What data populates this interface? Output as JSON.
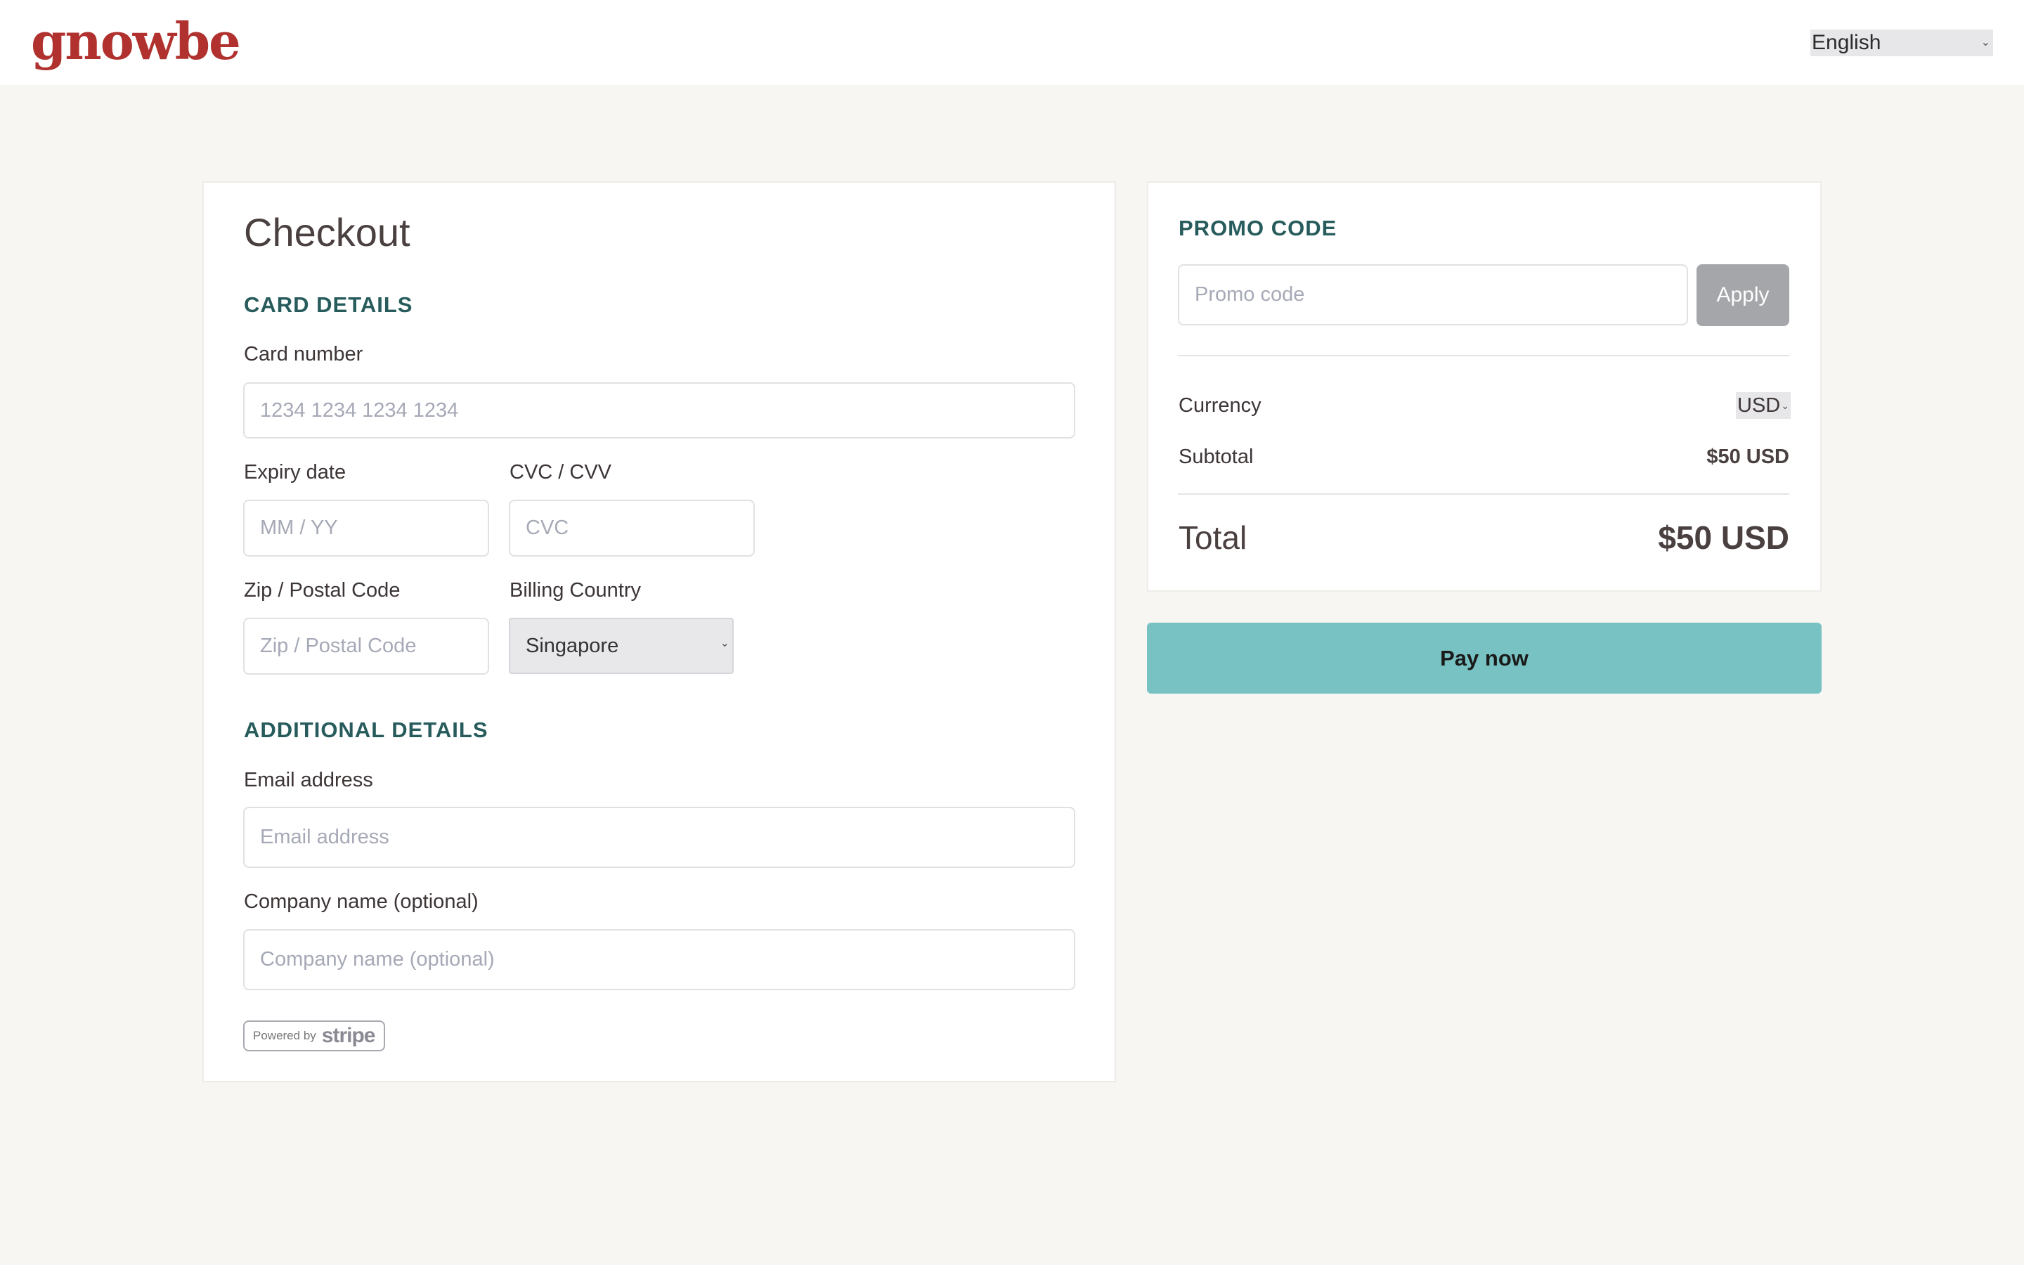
{
  "header": {
    "logo": "gnowbe",
    "language": "English"
  },
  "checkout": {
    "title": "Checkout",
    "card_section": "CARD DETAILS",
    "card_number_label": "Card number",
    "card_number_placeholder": "1234 1234 1234 1234",
    "expiry_label": "Expiry date",
    "expiry_placeholder": "MM / YY",
    "cvc_label": "CVC / CVV",
    "cvc_placeholder": "CVC",
    "zip_label": "Zip / Postal Code",
    "zip_placeholder": "Zip / Postal Code",
    "country_label": "Billing Country",
    "country_value": "Singapore",
    "additional_section": "ADDITIONAL DETAILS",
    "email_label": "Email address",
    "email_placeholder": "Email address",
    "company_label": "Company name (optional)",
    "company_placeholder": "Company name (optional)",
    "stripe_powered": "Powered by",
    "stripe_brand": "stripe"
  },
  "summary": {
    "promo_section": "PROMO CODE",
    "promo_placeholder": "Promo code",
    "apply_label": "Apply",
    "currency_label": "Currency",
    "currency_value": "USD",
    "subtotal_label": "Subtotal",
    "subtotal_value": "$50 USD",
    "total_label": "Total",
    "total_value": "$50 USD",
    "pay_label": "Pay now"
  }
}
